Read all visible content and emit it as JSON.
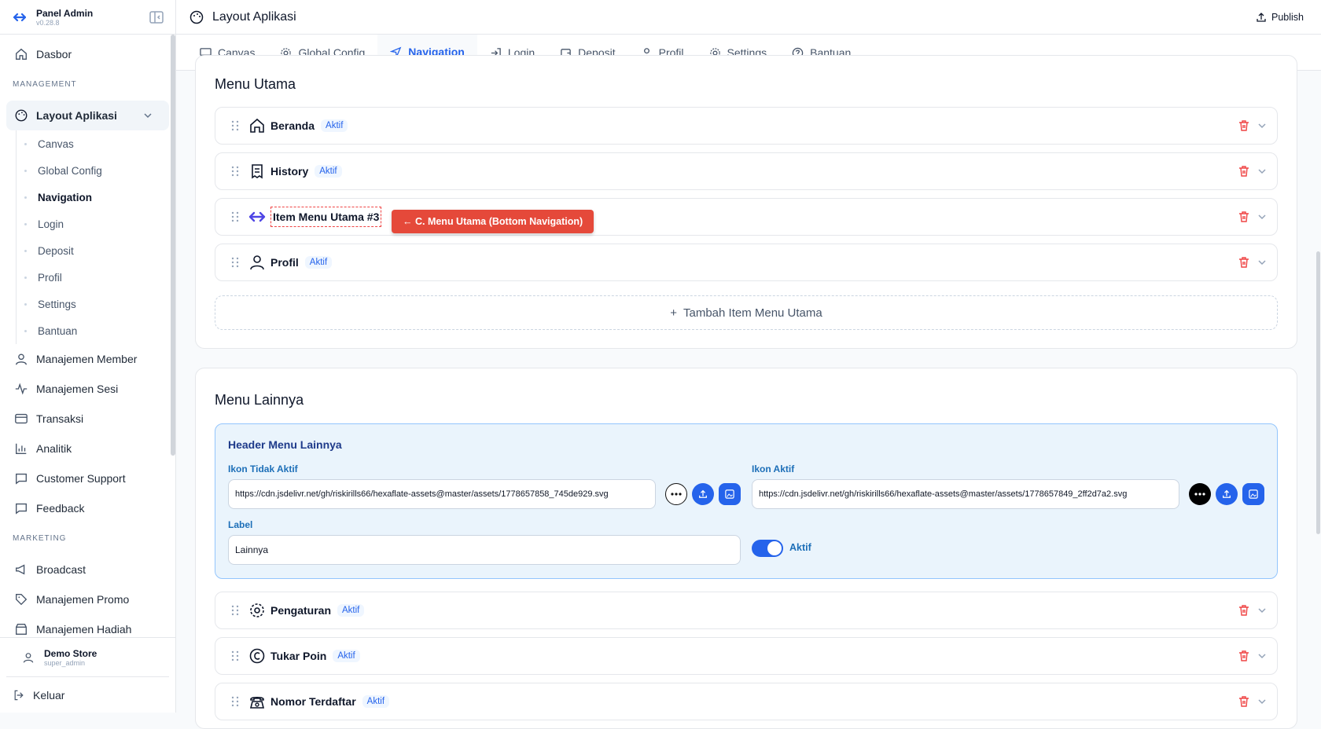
{
  "sidebar": {
    "brand_title": "Panel Admin",
    "brand_version": "v0.28.8",
    "dashboard": "Dasbor",
    "section_management": "MANAGEMENT",
    "layout_group": "Layout Aplikasi",
    "sub_items": [
      "Canvas",
      "Global Config",
      "Navigation",
      "Login",
      "Deposit",
      "Profil",
      "Settings",
      "Bantuan"
    ],
    "items": [
      "Manajemen Member",
      "Manajemen Sesi",
      "Transaksi",
      "Analitik",
      "Customer Support",
      "Feedback"
    ],
    "section_marketing": "MARKETING",
    "marketing_items": [
      "Broadcast",
      "Manajemen Promo",
      "Manajemen Hadiah"
    ],
    "user_name": "Demo Store",
    "user_role": "super_admin",
    "logout": "Keluar"
  },
  "topbar": {
    "title": "Layout Aplikasi",
    "publish": "Publish"
  },
  "tabs": [
    "Canvas",
    "Global Config",
    "Navigation",
    "Login",
    "Deposit",
    "Profil",
    "Settings",
    "Bantuan"
  ],
  "menu_utama": {
    "title": "Menu Utama",
    "items": [
      {
        "label": "Beranda",
        "badge": "Aktif"
      },
      {
        "label": "History",
        "badge": "Aktif"
      },
      {
        "label": "Item Menu Utama #3",
        "badge": ""
      },
      {
        "label": "Profil",
        "badge": "Aktif"
      }
    ],
    "callout": "← C. Menu Utama (Bottom Navigation)",
    "add_label": "Tambah Item Menu Utama"
  },
  "menu_lainnya": {
    "title": "Menu Lainnya",
    "header_title": "Header Menu Lainnya",
    "inactive_label": "Ikon Tidak Aktif",
    "inactive_value": "https://cdn.jsdelivr.net/gh/riskirills66/hexaflate-assets@master/assets/1778657858_745de929.svg",
    "active_label": "Ikon Aktif",
    "active_value": "https://cdn.jsdelivr.net/gh/riskirills66/hexaflate-assets@master/assets/1778657849_2ff2d7a2.svg",
    "label_label": "Label",
    "label_value": "Lainnya",
    "toggle_label": "Aktif",
    "items": [
      {
        "label": "Pengaturan",
        "badge": "Aktif"
      },
      {
        "label": "Tukar Poin",
        "badge": "Aktif"
      },
      {
        "label": "Nomor Terdaftar",
        "badge": "Aktif"
      }
    ]
  },
  "colors": {
    "accent": "#2563eb",
    "danger": "#ef4444",
    "callout": "#e5493a"
  }
}
